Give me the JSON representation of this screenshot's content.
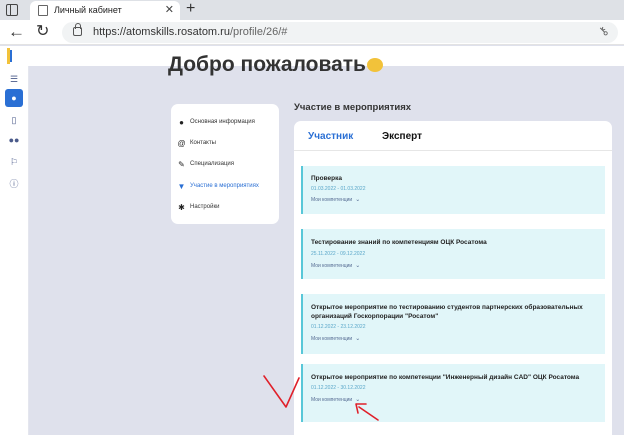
{
  "browser": {
    "tab_title": "Личный кабинет",
    "tab_close": "✕",
    "new_tab": "+",
    "back": "←",
    "reload": "↻",
    "url_host": "https://atomskills.rosatom.ru",
    "url_path": "/profile/26/#"
  },
  "page": {
    "welcome": "Добро пожаловать",
    "section_title": "Участие в мероприятиях"
  },
  "sidebar_icons": [
    "list-icon",
    "user-icon",
    "book-icon",
    "users-icon",
    "flag-icon",
    "info-icon"
  ],
  "menu": {
    "items": [
      {
        "label": "Основная информация",
        "icon": "user-icon"
      },
      {
        "label": "Контакты",
        "icon": "at-icon"
      },
      {
        "label": "Специализация",
        "icon": "wrench-icon"
      },
      {
        "label": "Участие в мероприятиях",
        "icon": "trophy-icon",
        "active": true
      },
      {
        "label": "Настройки",
        "icon": "gear-icon"
      }
    ]
  },
  "tabs": {
    "participant": "Участник",
    "expert": "Эксперт"
  },
  "events": [
    {
      "title": "Проверка",
      "dates": "01.03.2022 - 01.03.2022",
      "link": "Мои компетенции"
    },
    {
      "title": "Тестирование знаний по компетенциям ОЦК Росатома",
      "dates": "25.11.2022 - 09.12.2022",
      "link": "Мои компетенции"
    },
    {
      "title": "Открытое мероприятие по тестированию студентов партнерских образовательных организаций Госкорпорации \"Росатом\"",
      "dates": "01.12.2022 - 23.12.2022",
      "link": "Мои компетенции"
    },
    {
      "title": "Открытое мероприятие по компетенции \"Инженерный дизайн CAD\" ОЦК Росатома",
      "dates": "01.12.2022 - 30.12.2022",
      "link": "Мои компетенции"
    }
  ],
  "colors": {
    "accent": "#2a6fd4",
    "event_bg": "#e1f6f9",
    "event_border": "#58c7d8",
    "annotation": "#e0202a"
  }
}
